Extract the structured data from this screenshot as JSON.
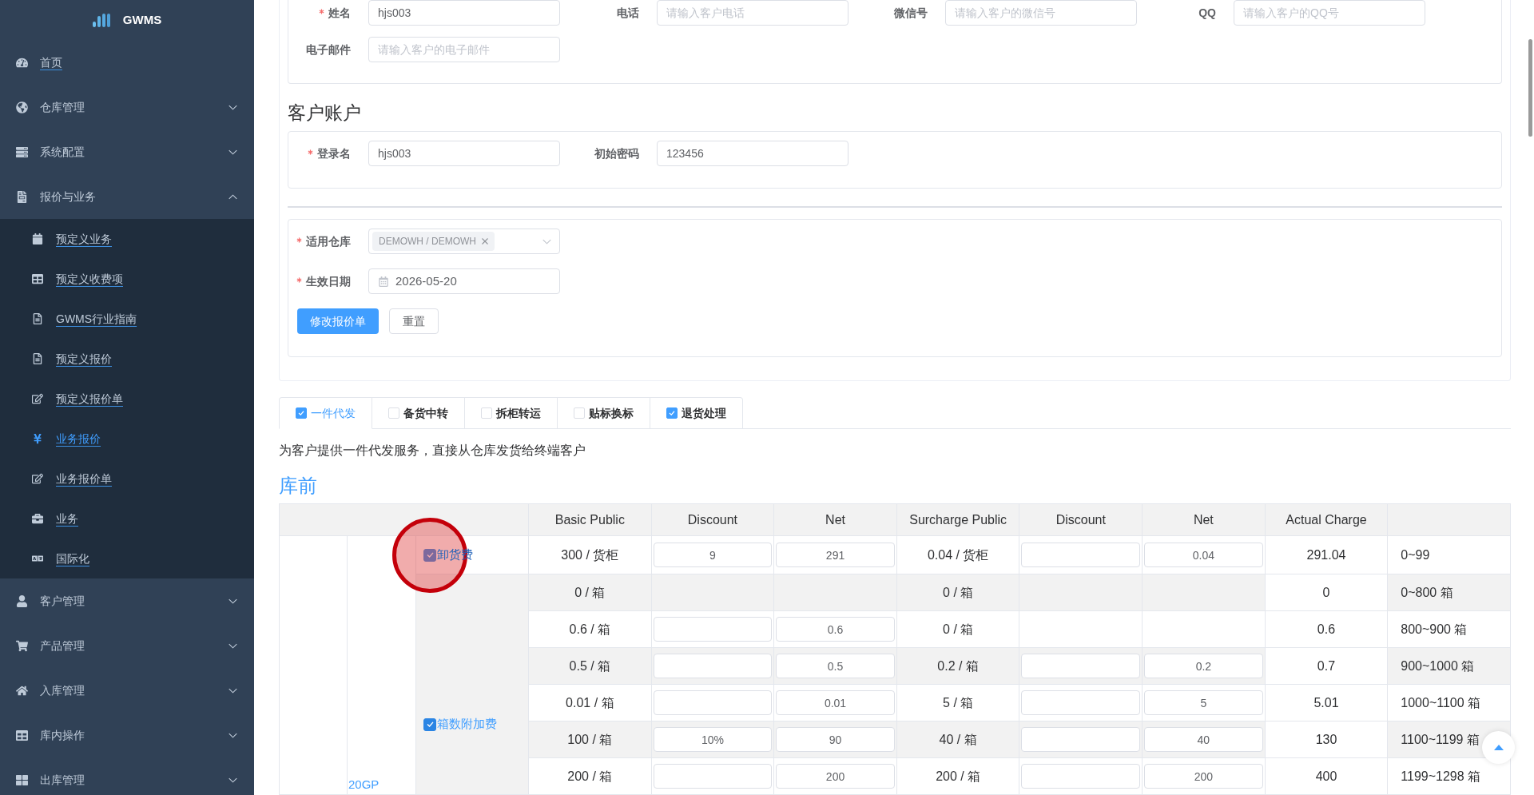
{
  "sidebar": {
    "logo_text": "GWMS",
    "items": [
      {
        "label": "首页",
        "kind": "link"
      },
      {
        "label": "仓库管理",
        "kind": "group",
        "expanded": false
      },
      {
        "label": "系统配置",
        "kind": "group",
        "expanded": false
      },
      {
        "label": "报价与业务",
        "kind": "group",
        "expanded": true,
        "children": [
          {
            "label": "预定义业务",
            "selected": false
          },
          {
            "label": "预定义收费项",
            "selected": false
          },
          {
            "label": "GWMS行业指南",
            "selected": false
          },
          {
            "label": "预定义报价",
            "selected": false
          },
          {
            "label": "预定义报价单",
            "selected": false
          },
          {
            "label": "业务报价",
            "selected": true
          },
          {
            "label": "业务报价单",
            "selected": false
          },
          {
            "label": "业务",
            "selected": false
          },
          {
            "label": "国际化",
            "selected": false
          }
        ]
      },
      {
        "label": "客户管理",
        "kind": "group",
        "expanded": false
      },
      {
        "label": "产品管理",
        "kind": "group",
        "expanded": false
      },
      {
        "label": "入库管理",
        "kind": "group",
        "expanded": false
      },
      {
        "label": "库内操作",
        "kind": "group",
        "expanded": false
      },
      {
        "label": "出库管理",
        "kind": "group",
        "expanded": false
      }
    ]
  },
  "customer_info": {
    "fields": [
      {
        "label": "姓名",
        "required": true,
        "value": "hjs003"
      },
      {
        "label": "电话",
        "required": false,
        "placeholder": "请输入客户电话"
      },
      {
        "label": "微信号",
        "required": false,
        "placeholder": "请输入客户的微信号"
      },
      {
        "label": "QQ",
        "required": false,
        "placeholder": "请输入客户的QQ号"
      },
      {
        "label": "电子邮件",
        "required": false,
        "placeholder": "请输入客户的电子邮件"
      }
    ]
  },
  "customer_account": {
    "title": "客户账户",
    "fields": [
      {
        "label": "登录名",
        "required": true,
        "value": "hjs003"
      },
      {
        "label": "初始密码",
        "required": false,
        "value": "123456"
      }
    ]
  },
  "quote_settings": {
    "fields": [
      {
        "label": "适用仓库",
        "required": true,
        "kind": "select",
        "tags": [
          "DEMOWH / DEMOWH"
        ]
      },
      {
        "label": "生效日期",
        "required": true,
        "kind": "date",
        "value": "2026-05-20"
      }
    ],
    "buttons": [
      {
        "label": "修改报价单",
        "kind": "primary"
      },
      {
        "label": "重置",
        "kind": "default"
      }
    ]
  },
  "service_tabs": [
    {
      "label": "一件代发",
      "checked": true,
      "selected": true
    },
    {
      "label": "备货中转",
      "checked": false,
      "selected": false
    },
    {
      "label": "拆柜转运",
      "checked": false,
      "selected": false
    },
    {
      "label": "贴标换标",
      "checked": false,
      "selected": false
    },
    {
      "label": "退货处理",
      "checked": true,
      "selected": false
    }
  ],
  "service_description": "为客户提供一件代发服务，直接从仓库发货给终端客户",
  "pricing": {
    "title": "库前",
    "table": {
      "columns": [
        "Basic Public",
        "Discount",
        "Net",
        "Surcharge Public",
        "Discount",
        "Net",
        "Actual Charge"
      ],
      "group_label": "20GP",
      "fees": [
        {
          "label": "卸货费",
          "checked": true,
          "highlighted": true,
          "rows": [
            {
              "basic_public": "300 / 货柜",
              "discount": {
                "kind": "input",
                "value": "9"
              },
              "net": {
                "kind": "input",
                "value": "291"
              },
              "surcharge_public": "0.04 / 货柜",
              "surcharge_discount": {
                "kind": "input"
              },
              "surcharge_net": {
                "kind": "input",
                "value": "0.04"
              },
              "actual_charge": "291.04",
              "column_8": "0~99"
            }
          ]
        },
        {
          "label": "箱数附加费",
          "checked": true,
          "highlighted": false,
          "rows": [
            {
              "basic_public": "0 / 箱",
              "discount": {
                "kind": "blank"
              },
              "net": {
                "kind": "blank"
              },
              "surcharge_public": "0 / 箱",
              "surcharge_discount": {
                "kind": "blank"
              },
              "surcharge_net": {
                "kind": "blank"
              },
              "actual_charge": "0",
              "column_8": "0~800 箱"
            },
            {
              "basic_public": "0.6 / 箱",
              "discount": {
                "kind": "input"
              },
              "net": {
                "kind": "input",
                "value": "0.6"
              },
              "surcharge_public": "0 / 箱",
              "surcharge_discount": {
                "kind": "blank"
              },
              "surcharge_net": {
                "kind": "blank"
              },
              "actual_charge": "0.6",
              "column_8": "800~900 箱"
            },
            {
              "basic_public": "0.5 / 箱",
              "discount": {
                "kind": "input"
              },
              "net": {
                "kind": "input",
                "value": "0.5"
              },
              "surcharge_public": "0.2 / 箱",
              "surcharge_discount": {
                "kind": "input"
              },
              "surcharge_net": {
                "kind": "input",
                "value": "0.2"
              },
              "actual_charge": "0.7",
              "column_8": "900~1000 箱"
            },
            {
              "basic_public": "0.01 / 箱",
              "discount": {
                "kind": "input"
              },
              "net": {
                "kind": "input",
                "value": "0.01"
              },
              "surcharge_public": "5 / 箱",
              "surcharge_discount": {
                "kind": "input"
              },
              "surcharge_net": {
                "kind": "input",
                "value": "5"
              },
              "actual_charge": "5.01",
              "column_8": "1000~1100 箱"
            },
            {
              "basic_public": "100 / 箱",
              "discount": {
                "kind": "input",
                "value": "10%"
              },
              "net": {
                "kind": "input",
                "value": "90"
              },
              "surcharge_public": "40 / 箱",
              "surcharge_discount": {
                "kind": "input"
              },
              "surcharge_net": {
                "kind": "input",
                "value": "40"
              },
              "actual_charge": "130",
              "column_8": "1100~1199 箱"
            },
            {
              "basic_public": "200 / 箱",
              "discount": {
                "kind": "input"
              },
              "net": {
                "kind": "input",
                "value": "200"
              },
              "surcharge_public": "200 / 箱",
              "surcharge_discount": {
                "kind": "input"
              },
              "surcharge_net": {
                "kind": "input",
                "value": "200"
              },
              "actual_charge": "400",
              "column_8": "1199~1298 箱"
            }
          ]
        }
      ]
    }
  }
}
